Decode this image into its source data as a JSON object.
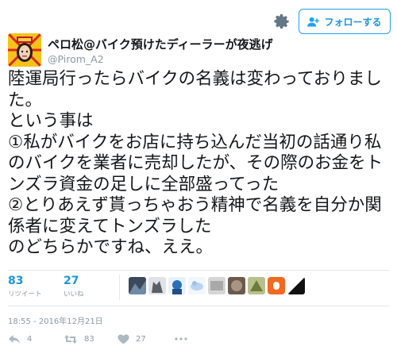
{
  "header": {
    "follow_label": "フォローする",
    "settings_icon": "gear-icon",
    "follow_icon": "person-add-icon"
  },
  "author": {
    "display_name": "ペロ松@バイク預けたディーラーが夜逃げ",
    "handle": "@Pirom_A2"
  },
  "tweet": {
    "text": "陸運局行ったらバイクの名義は変わっておりました。\nという事は\n①私がバイクをお店に持ち込んだ当初の話通り私のバイクを業者に売却したが、その際のお金をトンズラ資金の足しに全部盛ってった\n②とりあえず貰っちゃおう精神で名義を自分か関係者に変えてトンズラした\nのどちらかですね、ええ。"
  },
  "stats": {
    "retweets": {
      "count": "83",
      "label": "リツイート"
    },
    "likes": {
      "count": "27",
      "label": "いいね"
    }
  },
  "timestamp": "18:55 - 2016年12月21日",
  "actions": {
    "reply_count": "4",
    "retweet_count": "83",
    "like_count": "27"
  },
  "colors": {
    "accent": "#1da1f2",
    "link": "#1b95e0",
    "muted": "#8899a6",
    "divider": "#e1e8ed",
    "like": "#aab8c2"
  }
}
